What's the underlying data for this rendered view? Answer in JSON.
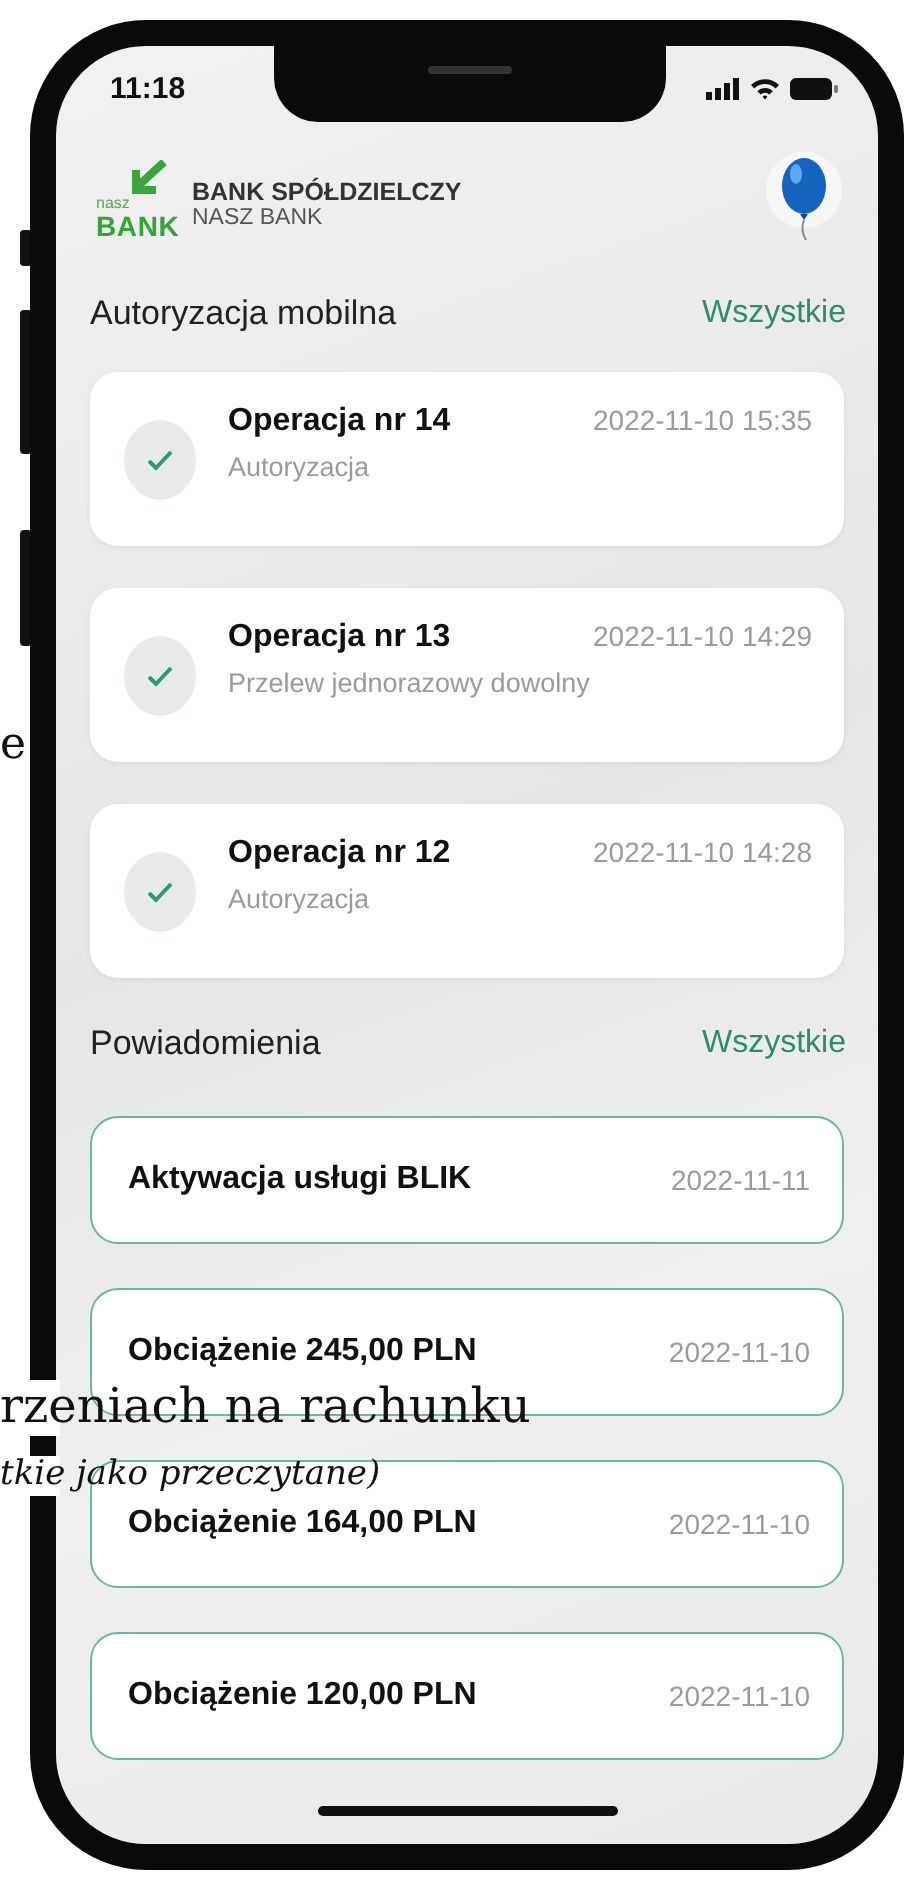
{
  "status_bar": {
    "time": "11:18"
  },
  "header": {
    "logo_small": "nasz",
    "logo_big": "BANK",
    "bank_name": "BANK SPÓŁDZIELCZY",
    "bank_subname": "NASZ BANK"
  },
  "authorizations": {
    "title": "Autoryzacja mobilna",
    "link": "Wszystkie",
    "items": [
      {
        "title": "Operacja nr 14",
        "subtitle": "Autoryzacja",
        "date": "2022-11-10 15:35",
        "checked": true
      },
      {
        "title": "Operacja nr 13",
        "subtitle": "Przelew jednorazowy dowolny",
        "date": "2022-11-10 14:29",
        "checked": true
      },
      {
        "title": "Operacja nr 12",
        "subtitle": "Autoryzacja",
        "date": "2022-11-10 14:28",
        "checked": true
      }
    ]
  },
  "notifications": {
    "title": "Powiadomienia",
    "link": "Wszystkie",
    "items": [
      {
        "title": "Aktywacja usługi BLIK",
        "date": "2022-11-11"
      },
      {
        "title": "Obciążenie 245,00 PLN",
        "date": "2022-11-10"
      },
      {
        "title": "Obciążenie 164,00 PLN",
        "date": "2022-11-10"
      },
      {
        "title": "Obciążenie 120,00 PLN",
        "date": "2022-11-10"
      }
    ]
  },
  "document_fragments": [
    {
      "text": "e",
      "kind": "plain"
    },
    {
      "text": "rzeniach na rachunku",
      "kind": "plain"
    },
    {
      "text": "tkie jako przeczytane)",
      "kind": "italic"
    }
  ]
}
